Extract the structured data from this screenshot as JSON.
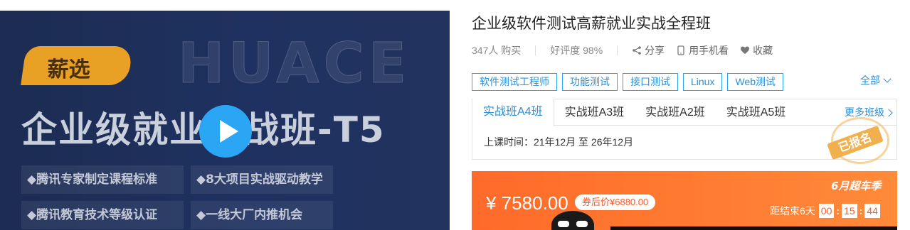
{
  "banner": {
    "bg_text": "HUACE",
    "tag": "薪选",
    "title": "企业级就业实战班-T5",
    "features": [
      "◆腾讯专家制定课程标准",
      "◆8大项目实战驱动教学",
      "◆腾讯教育技术等级认证",
      "◆一线大厂内推机会"
    ]
  },
  "course": {
    "title": "企业级软件测试高薪就业实战全程班",
    "purchases": "347人 购买",
    "rating": "好评度 98%",
    "actions": {
      "share": "分享",
      "mobile": "用手机看",
      "favorite": "收藏"
    },
    "tags": [
      "软件测试工程师",
      "功能测试",
      "接口测试",
      "Linux",
      "Web测试"
    ],
    "all_label": "全部",
    "classes": [
      "实战班A4班",
      "实战班A3班",
      "实战班A2班",
      "实战班A5班"
    ],
    "more_classes": "更多班级",
    "schedule": "上课时间：21年12月 至 26年12月",
    "enrolled_stamp": "已报名"
  },
  "pricing": {
    "price": "¥ 7580.00",
    "coupon": "券后价¥6880.00",
    "promo": "6月超车季",
    "countdown_label": "距结束6天",
    "hours": "00",
    "minutes": "15",
    "seconds": "44"
  },
  "colors": {
    "accent": "#2ba6f5",
    "price_bar": "#ff7a30",
    "banner_bg": "#1f3160",
    "tag": "#e8a025"
  }
}
